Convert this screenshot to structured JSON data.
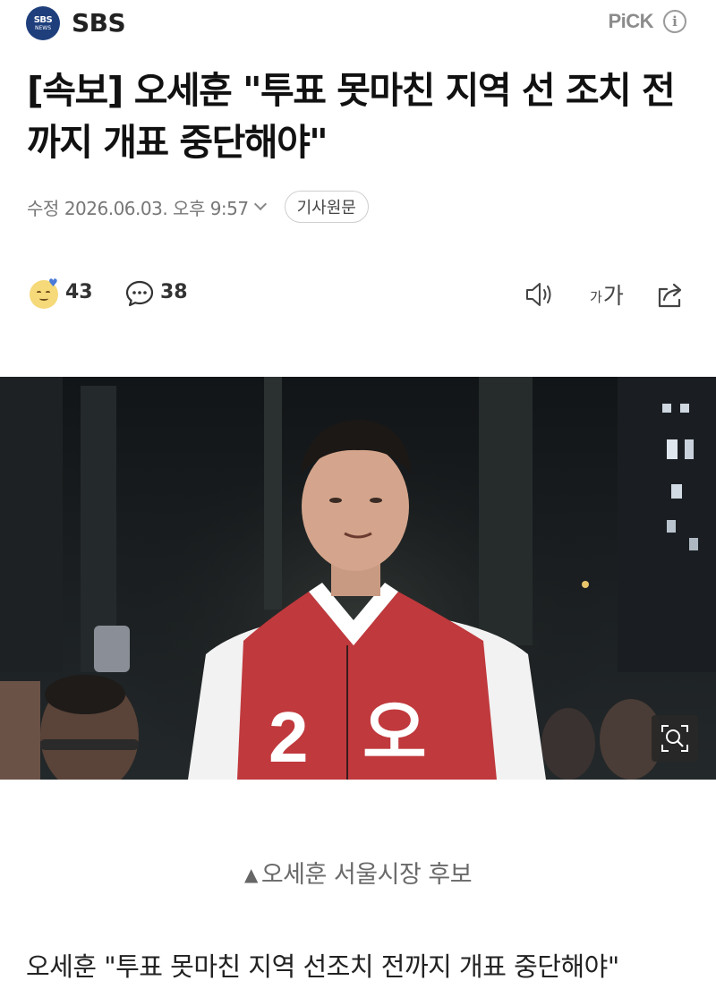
{
  "press": {
    "logo_line1": "SBS",
    "logo_line2": "NEWS",
    "name": "SBS",
    "pick_label": "PiCK",
    "info_icon": "info-icon"
  },
  "article": {
    "headline": "[속보] 오세훈 \"투표 못마친 지역 선 조치 전까지 개표 중단해야\"",
    "modified_label": "수정",
    "modified_date": "2026.06.03. 오후 9:57",
    "original_button": "기사원문",
    "photo_caption": "오세훈 서울시장 후보",
    "subheadline": "오세훈 \"투표 못마친 지역 선조치 전까지 개표 중단해야\""
  },
  "actions": {
    "reaction_count": "43",
    "comment_count": "38",
    "fontsize_small": "가",
    "fontsize_big": "가",
    "icons": [
      "smile-reaction-icon",
      "comment-icon",
      "speaker-icon",
      "font-size-icon",
      "share-icon",
      "zoom-icon"
    ]
  },
  "photo": {
    "vest_number": "2",
    "vest_text": "오"
  },
  "colors": {
    "logo_bg": "#1e3f7c",
    "vest_red": "#c0393d",
    "text_primary": "#111111",
    "text_meta": "#777777"
  }
}
